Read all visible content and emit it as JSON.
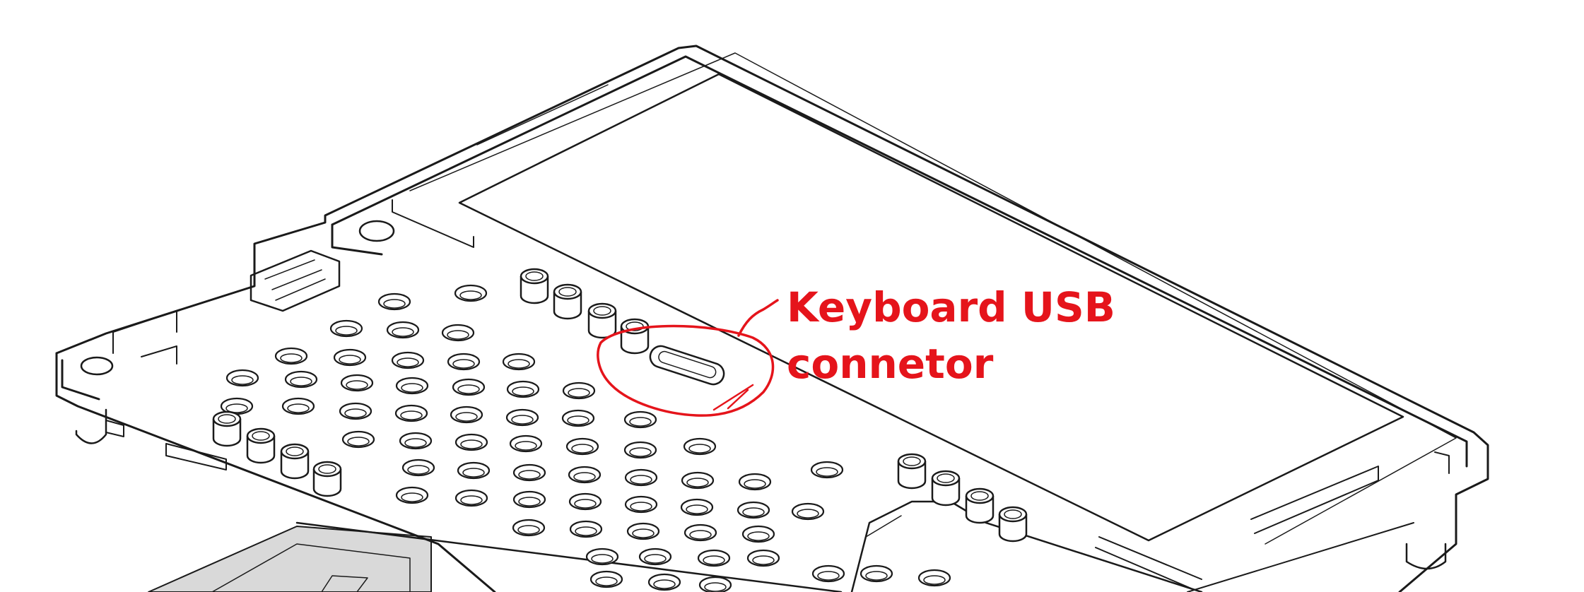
{
  "annotation": {
    "line1": "Keyboard USB",
    "line2": "connetor"
  },
  "colors": {
    "annotation": "#e5141b",
    "linework": "#1a1a1a",
    "background": "#ffffff",
    "tray": "#d9d9d9"
  }
}
